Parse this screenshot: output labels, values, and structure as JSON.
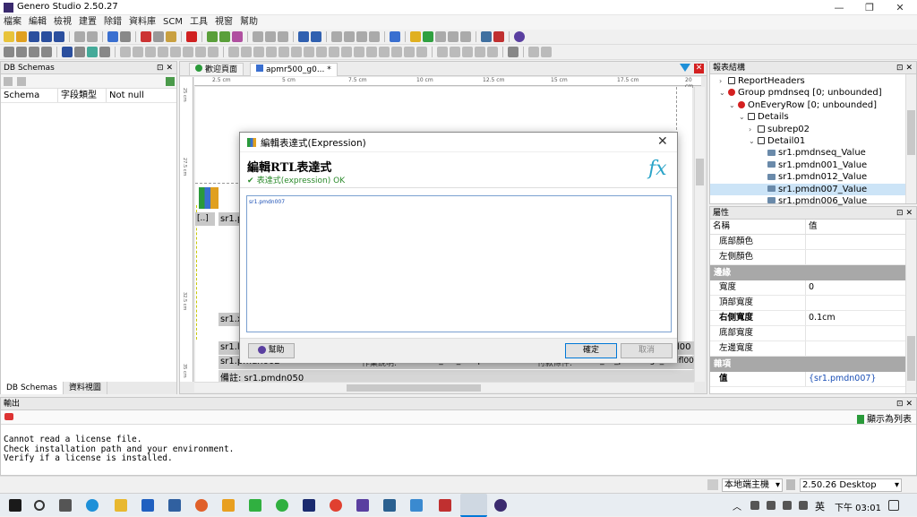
{
  "window": {
    "title": "Genero Studio 2.50.27",
    "minimize": "—",
    "maximize": "❐",
    "close": "✕"
  },
  "menu": [
    "檔案",
    "編輯",
    "檢視",
    "建置",
    "除錯",
    "資料庫",
    "SCM",
    "工具",
    "視窗",
    "幫助"
  ],
  "db_schemas": {
    "title": "DB Schemas",
    "columns": [
      "Schema",
      "字段類型",
      "Not null"
    ],
    "tabs": [
      "DB Schemas",
      "資料視圖"
    ]
  },
  "editor": {
    "tabs": [
      "歡迎頁面",
      "apmr500_g0... *"
    ],
    "ruler": [
      "2.5 cm",
      "5 cm",
      "7.5 cm",
      "10 cm",
      "12.5 cm",
      "15 cm",
      "17.5 cm",
      "20 cm"
    ],
    "canvas_items": [
      "[..]",
      "sr1.p",
      "sr1.x",
      "sr1.l",
      "sr1.pmdn002",
      "作業說明:",
      "sr1.x_t13_oocq004",
      "付款條件:",
      "sr1_13_pmdnorga_ooefl00",
      "備註: sr1.pmdn050",
      "l00"
    ],
    "vruler": [
      "25 cm",
      "27.5 cm",
      "32.5 cm",
      "35 cm"
    ]
  },
  "report_structure": {
    "title": "報表結構",
    "rows": [
      {
        "label": "ReportHeaders",
        "indent": 2,
        "icon": "box"
      },
      {
        "label": "Group pmdnseq [0; unbounded]",
        "indent": 2,
        "icon": "red"
      },
      {
        "label": "OnEveryRow [0; unbounded]",
        "indent": 3,
        "icon": "red"
      },
      {
        "label": "Details",
        "indent": 4,
        "icon": "box"
      },
      {
        "label": "subrep02",
        "indent": 5,
        "icon": "box"
      },
      {
        "label": "Detail01",
        "indent": 5,
        "icon": "box"
      },
      {
        "label": "sr1.pmdnseq_Value",
        "indent": 6,
        "icon": "field"
      },
      {
        "label": "sr1.pmdn001_Value",
        "indent": 6,
        "icon": "field"
      },
      {
        "label": "sr1.pmdn012_Value",
        "indent": 6,
        "icon": "field"
      },
      {
        "label": "sr1.pmdn007_Value",
        "indent": 6,
        "icon": "field",
        "selected": true
      },
      {
        "label": "sr1.pmdn006_Value",
        "indent": 6,
        "icon": "field"
      }
    ]
  },
  "properties": {
    "title": "屬性",
    "col_name": "名稱",
    "col_value": "值",
    "rows": [
      {
        "type": "row",
        "k": "底部顏色",
        "v": ""
      },
      {
        "type": "row",
        "k": "左側顏色",
        "v": ""
      },
      {
        "type": "sec",
        "k": "邊緣"
      },
      {
        "type": "row",
        "k": "寬度",
        "v": "0"
      },
      {
        "type": "row",
        "k": "頂部寬度",
        "v": ""
      },
      {
        "type": "row",
        "k": "右側寬度",
        "v": "0.1cm",
        "bold": true
      },
      {
        "type": "row",
        "k": "底部寬度",
        "v": ""
      },
      {
        "type": "row",
        "k": "左邊寬度",
        "v": ""
      },
      {
        "type": "sec",
        "k": "雜項"
      },
      {
        "type": "row",
        "k": "值",
        "v": "{sr1.pmdn007}",
        "bold": true,
        "link": true
      }
    ]
  },
  "output": {
    "title": "輸出",
    "show_as_list": "顯示為列表",
    "lines": [
      "Cannot read a license file.",
      "Check installation path and your environment.",
      "Verify if a license is installed."
    ]
  },
  "statusbar": {
    "host": "本地端主機",
    "version": "2.50.26 Desktop"
  },
  "dialog": {
    "title": "編輯表達式(Expression)",
    "heading": "編輯RTL表達式",
    "status": "表達式(expression) OK",
    "fx": "fx",
    "expression": "sr1.pmdn007",
    "help": "幫助",
    "ok": "確定",
    "cancel": "取消"
  },
  "taskbar": {
    "ime": "英",
    "time": "下午 03:01"
  },
  "colors": {
    "accent": "#0078d7",
    "selection": "#cce4f7",
    "red_node": "#d42020",
    "fx": "#2aa4c8",
    "link": "#1b4fb5"
  }
}
